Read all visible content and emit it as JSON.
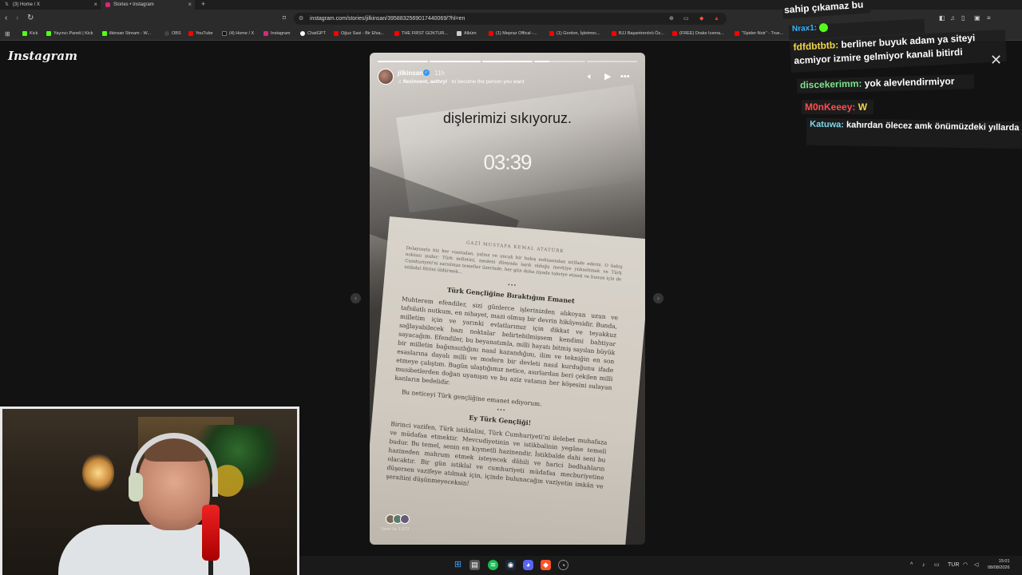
{
  "browser": {
    "tabs": [
      {
        "label": "(3) Home / X",
        "icon": "x-logo-icon",
        "active": false
      },
      {
        "label": "Stories • Instagram",
        "icon": "instagram-icon",
        "active": true
      }
    ],
    "url": "instagram.com/stories/jilkinsan/3958832569017440069/?hl=en",
    "bookmarks": [
      {
        "label": "Kick",
        "color": "#53fc18"
      },
      {
        "label": "Yayıncı Paneli | Kick",
        "color": "#53fc18"
      },
      {
        "label": "ilkinsan Stream - W...",
        "color": "#53fc18"
      },
      {
        "label": "OBS",
        "color": "#444444"
      },
      {
        "label": "YouTube",
        "color": "#ff0000"
      },
      {
        "label": "(4) Home / X",
        "color": "#111111"
      },
      {
        "label": "Instagram",
        "color": "#d62976"
      },
      {
        "label": "ChatGPT",
        "color": "#ffffff"
      },
      {
        "label": "Oğuz Sasi - Bir Efsa...",
        "color": "#ff0000"
      },
      {
        "label": "THE FIRST GOKTUR...",
        "color": "#ff0000"
      },
      {
        "label": "Albüm",
        "color": "#cccccc"
      },
      {
        "label": "(1) Mepraz Offical -...",
        "color": "#ff0000"
      },
      {
        "label": "(1) Gordon, İşletmec...",
        "color": "#ff0000"
      },
      {
        "label": "BJJ Başantrenörü Öz...",
        "color": "#ff0000"
      },
      {
        "label": "(FREE) Drake Icema...",
        "color": "#ff0000"
      },
      {
        "label": "\"Spider-Noir\" - True...",
        "color": "#ff0000"
      }
    ]
  },
  "page": {
    "logo": "Instagram"
  },
  "story": {
    "username": "jilkinsan",
    "time_ago": "11h",
    "music_artists": "flexinvent, aethryl",
    "music_title": "to become the person you want",
    "caption": "dişlerimizi sıkıyoruz.",
    "timer": "03:39",
    "seen_by": "Seen by 1,673",
    "segments": [
      "done",
      "done",
      "done",
      "partial",
      "empty"
    ],
    "book": {
      "header": "GAZİ MUSTAFA KEMAL ATATÜRK",
      "intro": "Dolayısıyla biz her vasıtadan, yalnız ve ancak bir bakış noktasından istifade ederiz. O bakış noktası şudur: Türk milletini, medeni dünyada layık olduğu mevkiye yükseltmek ve Türk Cumhuriyeti'ni sarsılmaz temeller üzerinde, her gün daha ziyade takviye etmek ve bunun için de istibdat fikrini öldürmek...",
      "heading1": "Türk Gençliğine Bıraktığım Emanet",
      "body1": "Muhterem efendiler, sizi günlerce işlerinizden alıkoyan uzun ve tafsilatlı nutkum, en nihayet, mazi olmuş bir devrin hikâyesidir. Bunda, milletim için ve yarınki evlatlarımız için dikkat ve teyakkuz sağlayabilecek bazı noktalar belirtebilmişsem kendimi bahtiyar sayacağım. Efendiler, bu beyanatımla, milli hayatı bitmiş sayılan büyük bir milletin bağımsızlığını nasıl kazandığını, ilim ve tekniğin en son esaslarına dayalı milli ve modern bir devleti nasıl kurduğunu ifade etmeye çalıştım. Bugün ulaştığımız netice, asırlardan beri çekilen milli musibetlerden doğan uyanışın ve bu aziz vatanın her köşesini sulayan kanların bedelidir.",
      "body2": "Bu neticeyi Türk gençliğine emanet ediyorum.",
      "heading2": "Ey Türk Gençliği!",
      "body3": "Birinci vazifen, Türk istiklalini, Türk Cumhuriyeti'ni ilelebet muhafaza ve müdafaa etmektir. Mevcudiyetinin ve istikbalinin yegâne temeli budur. Bu temel, senin en kıymetli hazinendir. İstikbalde dahi seni bu hazineden mahrum etmek isteyecek dâhili ve harici bedhahların olacaktır. Bir gün istiklal ve cumhuriyeti müdafaa mecburiyetine düşersen vazifeye atılmak için, içinde bulunacağın vaziyetin imkân ve şeraitini düşünmeyeceksin!"
    }
  },
  "chat": [
    {
      "user": "",
      "text": "sahip çıkamaz bu",
      "color": "#ffffff"
    },
    {
      "user": "Nrax1:",
      "text": "",
      "color": "#38b6ff"
    },
    {
      "user": "fdfdbtbtb:",
      "text": "berliner buyuk adam ya siteyi acmiyor izmire gelmiyor kanali bitirdi",
      "color": "#f5d547"
    },
    {
      "user": "discekerimm:",
      "text": "yok alevlendirmiyor",
      "color": "#7ee28b"
    },
    {
      "user": "M0nKeeey:",
      "text": "W",
      "color": "#ff4d4d"
    },
    {
      "user": "Katuwa:",
      "text": "kahırdan ölecez amk önümüzdeki yıllarda",
      "color": "#7fd6e8"
    }
  ],
  "taskbar": {
    "language": "TUR",
    "time": "15:01",
    "date": "08/08/2026"
  }
}
